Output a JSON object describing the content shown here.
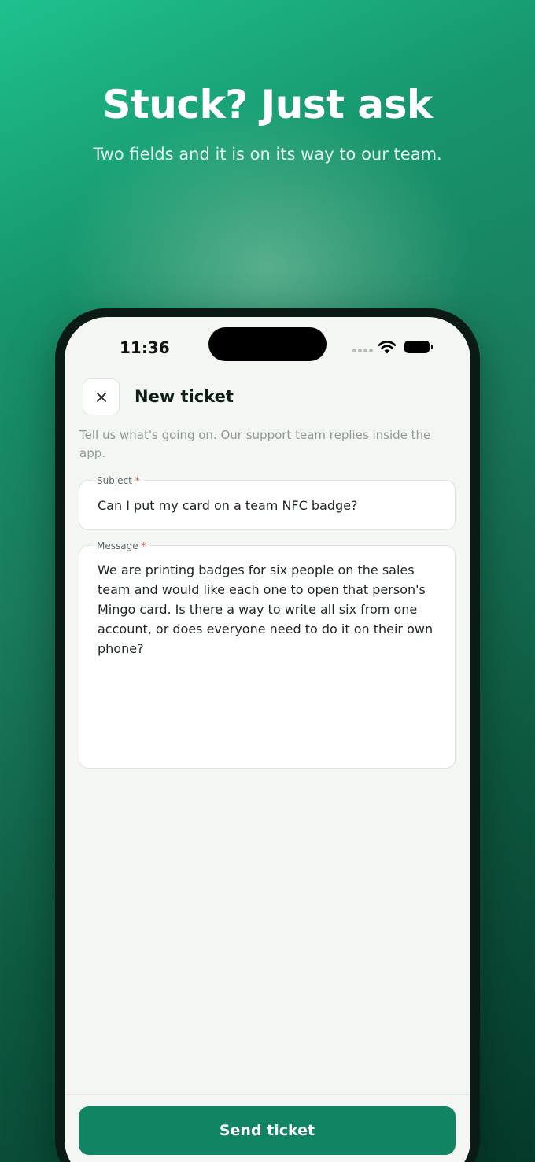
{
  "hero": {
    "title": "Stuck? Just ask",
    "subtitle": "Two fields and it is on its way to our team."
  },
  "status_bar": {
    "time": "11:36",
    "icons": [
      "signal-dots-icon",
      "wifi-icon",
      "battery-icon"
    ]
  },
  "header": {
    "close_icon": "close-icon",
    "title": "New ticket"
  },
  "intro": "Tell us what's going on. Our support team replies inside the app.",
  "form": {
    "subject": {
      "label": "Subject",
      "required_mark": "*",
      "value": "Can I put my card on a team NFC badge?"
    },
    "message": {
      "label": "Message",
      "required_mark": "*",
      "value": "We are printing badges for six people on the sales team and would like each one to open that person's Mingo card. Is there a way to write all six from one account, or does everyone need to do it on their own phone?"
    }
  },
  "actions": {
    "send_label": "Send ticket"
  },
  "colors": {
    "accent": "#118563",
    "background_top": "#1fc18e",
    "background_bottom": "#053a2b",
    "required": "#e04848"
  }
}
